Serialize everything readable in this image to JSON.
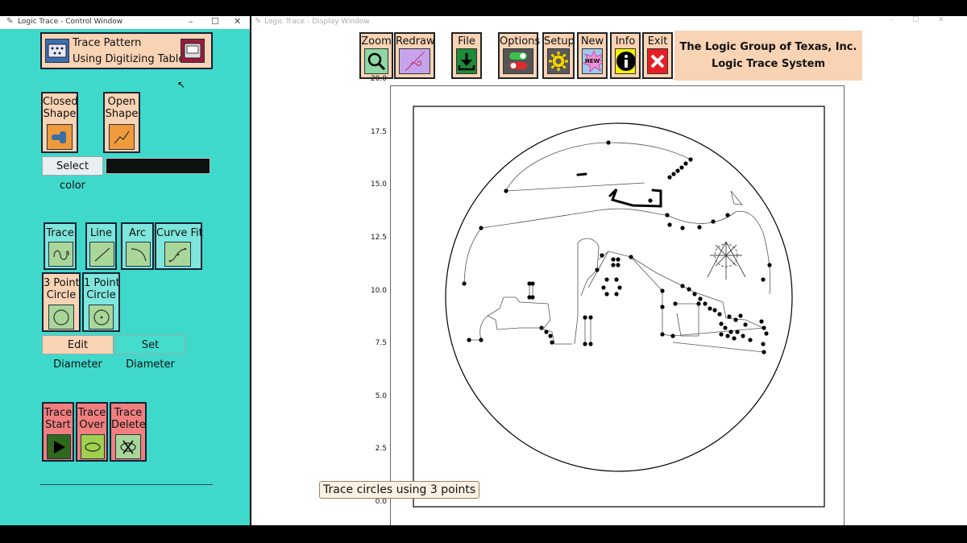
{
  "control": {
    "title": "Logic Trace - Control Window",
    "trace_pattern_line1": "Trace Pattern",
    "trace_pattern_line2": "Using Digitizing Tablet",
    "closed_shape_l1": "Closed",
    "closed_shape_l2": "Shape",
    "open_shape_l1": "Open",
    "open_shape_l2": "Shape",
    "select_color": "Select color",
    "selected_color": "#0d1110",
    "trace": "Trace",
    "line": "Line",
    "arc": "Arc",
    "curve_fit": "Curve Fit",
    "three_point_l1": "3 Point",
    "three_point_l2": "Circle",
    "one_point_l1": "1 Point",
    "one_point_l2": "Circle",
    "edit_diameter": "Edit Diameter",
    "set_diameter": "Set Diameter",
    "trace_start_l1": "Trace",
    "trace_start_l2": "Start",
    "trace_over_l1": "Trace",
    "trace_over_l2": "Over",
    "trace_delete_l1": "Trace",
    "trace_delete_l2": "Delete"
  },
  "display": {
    "title": "Logic Trace - Display Window",
    "toolbar": {
      "zoom": "Zoom",
      "redraw": "Redraw",
      "file": "File",
      "options": "Options",
      "setup": "Setup",
      "new": "New",
      "new_badge": "NEW",
      "info": "Info",
      "exit": "Exit"
    },
    "company_line1": "The Logic Group of Texas, Inc.",
    "company_line2": "Logic Trace System",
    "tooltip": "Trace circles using 3 points",
    "y_ticks": [
      "20.0",
      "17.5",
      "15.0",
      "12.5",
      "10.0",
      "7.5",
      "5.0",
      "2.5",
      "0.0"
    ]
  },
  "chart_data": {
    "type": "scatter",
    "ylim": [
      0,
      20
    ],
    "y_ticks": [
      0.0,
      2.5,
      5.0,
      7.5,
      10.0,
      12.5,
      15.0,
      17.5,
      20.0
    ],
    "grid": false
  }
}
